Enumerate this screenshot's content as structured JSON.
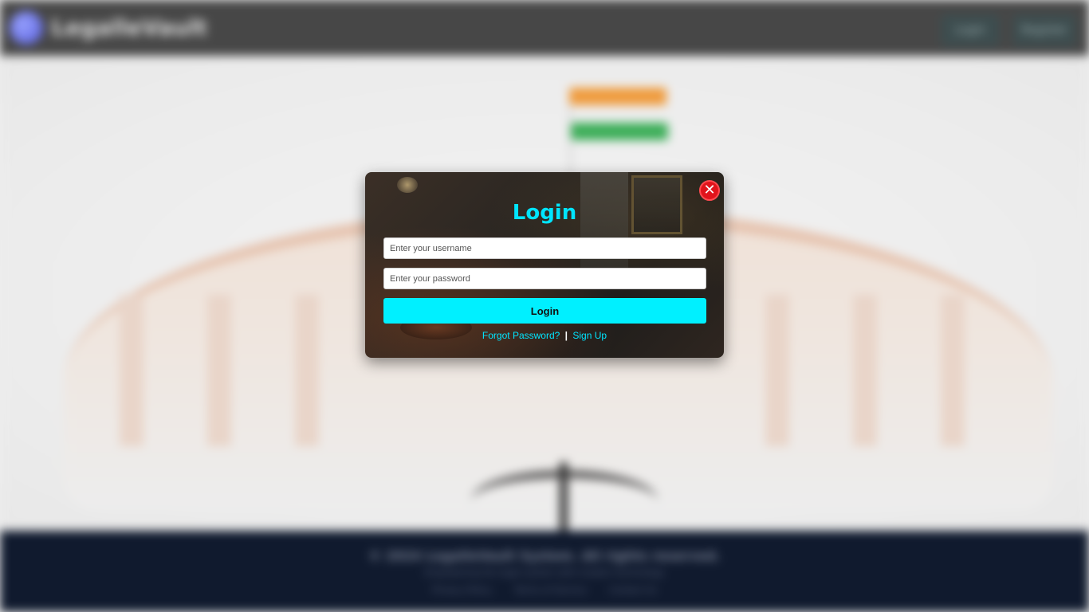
{
  "background": {
    "brand_name": "LegalleVault",
    "nav": {
      "login_label": "Login",
      "register_label": "Register"
    },
    "footer": {
      "copyright": "© 2024 LegalleVault System. All rights reserved.",
      "tagline": "Empowering the legal system with modern technology",
      "links": [
        "Privacy Policy",
        "Terms of Service",
        "Contact Us"
      ]
    },
    "blurred": true
  },
  "modal": {
    "title": "Login",
    "close_label": "✕",
    "username_placeholder": "Enter your username",
    "password_placeholder": "Enter your password",
    "submit_label": "Login",
    "forgot_password_label": "Forgot Password?",
    "separator": "|",
    "signup_label": "Sign Up"
  },
  "colors": {
    "accent": "#00e5ff",
    "button_bg": "#00f0ff",
    "close_bg": "#e1141c",
    "header_bg": "#474747",
    "footer_bg": "#101a2e"
  },
  "icons": {
    "close": "close-icon",
    "logo": "logo-icon"
  }
}
